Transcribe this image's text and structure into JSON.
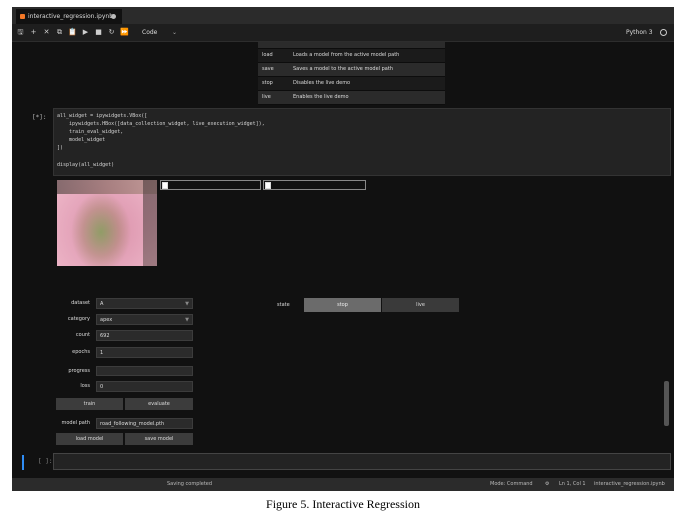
{
  "tab": {
    "title": "interactive_regression.ipynb"
  },
  "toolbar": {
    "buttons": [
      {
        "name": "save-icon",
        "glyph": "🖫"
      },
      {
        "name": "add-icon",
        "glyph": "+"
      },
      {
        "name": "cut-icon",
        "glyph": "✕"
      },
      {
        "name": "copy-icon",
        "glyph": "⧉"
      },
      {
        "name": "paste-icon",
        "glyph": "📋"
      },
      {
        "name": "run-icon",
        "glyph": "▶"
      },
      {
        "name": "stop-icon",
        "glyph": "■"
      },
      {
        "name": "restart-icon",
        "glyph": "↻"
      },
      {
        "name": "fast-forward-icon",
        "glyph": "⏩"
      }
    ],
    "cell_type": "Code",
    "cell_type_caret": "⌄",
    "kernel": "Python 3"
  },
  "doc_table": [
    {
      "key": "load",
      "value": "Loads a model from the active model path"
    },
    {
      "key": "save",
      "value": "Saves a model to the active model path"
    },
    {
      "key": "stop",
      "value": "Disables the live demo"
    },
    {
      "key": "live",
      "value": "Enables the live demo"
    }
  ],
  "code_cell": {
    "prompt": "[*]:",
    "lines": [
      "all_widget = ipywidgets.VBox([",
      "    ipywidgets.HBox([data_collection_widget, live_execution_widget]),",
      "    train_eval_widget,",
      "    model_widget",
      "])",
      "",
      "display(all_widget)"
    ]
  },
  "widgets": {
    "dataset": {
      "label": "dataset",
      "value": "A"
    },
    "category": {
      "label": "category",
      "value": "apex"
    },
    "count": {
      "label": "count",
      "value": "692"
    },
    "epochs": {
      "label": "epochs",
      "value": "1"
    },
    "progress": {
      "label": "progress",
      "value": 0
    },
    "loss": {
      "label": "loss",
      "value": "0"
    },
    "train_label": "train",
    "evaluate_label": "evaluate",
    "model_path": {
      "label": "model path",
      "value": "road_following_model.pth"
    },
    "load_label": "load model",
    "save_label": "save model",
    "state_label": "state",
    "stop_label": "stop",
    "live_label": "live"
  },
  "empty_cell": {
    "prompt": "[ ]:"
  },
  "statusbar": {
    "saving": "Saving completed",
    "mode": "Mode: Command",
    "position": "Ln 1, Col 1",
    "filename": "interactive_regression.ipynb"
  },
  "caption": "Figure 5. Interactive Regression"
}
